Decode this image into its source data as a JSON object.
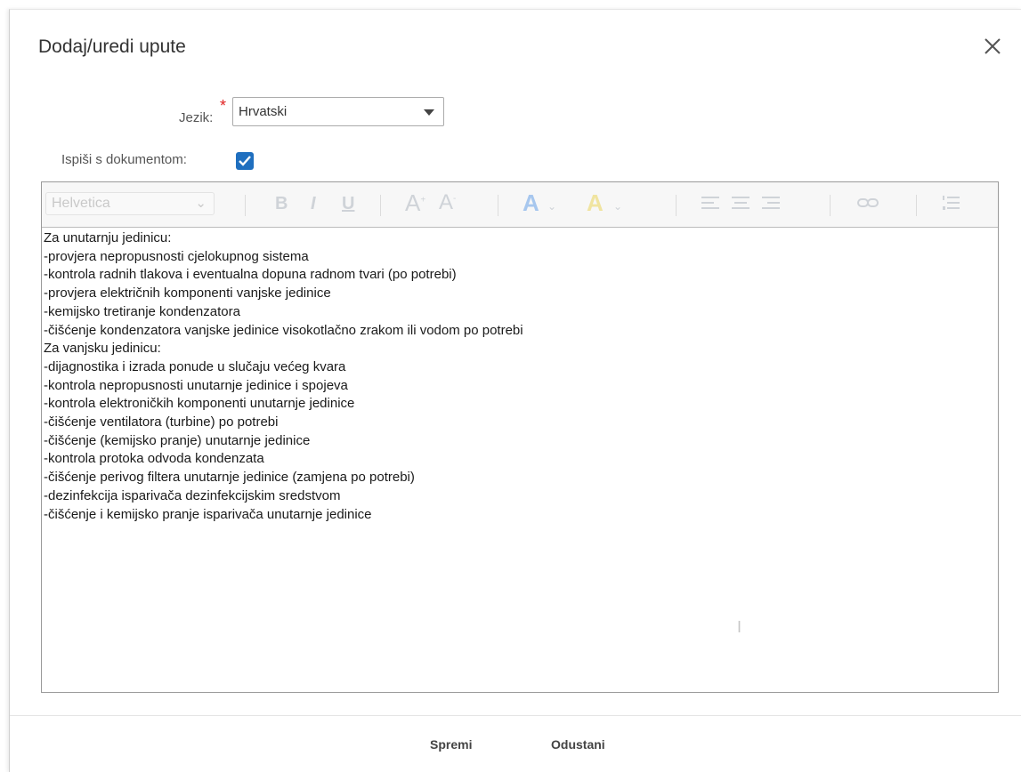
{
  "dialog": {
    "title": "Dodaj/uredi upute",
    "close_icon": "close-icon"
  },
  "form": {
    "language_label": "Jezik:",
    "required_mark": "*",
    "language_value": "Hrvatski",
    "print_label": "Ispiši s dokumentom:",
    "print_checked": true
  },
  "toolbar": {
    "font_value": "Helvetica",
    "bold": "B",
    "italic": "I",
    "underline": "U",
    "icons": [
      "font-size-increase-icon",
      "font-size-decrease-icon",
      "text-color-icon",
      "highlight-color-icon",
      "align-left-icon",
      "align-center-icon",
      "align-right-icon",
      "link-icon",
      "numbered-list-icon"
    ]
  },
  "editor": {
    "lines": [
      "Za unutarnju jedinicu:",
      "-provjera nepropusnosti cjelokupnog sistema",
      "-kontrola radnih tlakova i eventualna dopuna radnom tvari (po potrebi)",
      "-provjera električnih komponenti vanjske jedinice",
      "-kemijsko tretiranje kondenzatora",
      "-čišćenje kondenzatora vanjske jedinice visokotlačno zrakom ili vodom po potrebi",
      "Za vanjsku jedinicu:",
      "-dijagnostika i izrada ponude u slučaju većeg kvara",
      "-kontrola nepropusnosti unutarnje jedinice i spojeva",
      "-kontrola elektroničkih komponenti unutarnje jedinice",
      "-čišćenje ventilatora (turbine) po potrebi",
      "-čišćenje (kemijsko pranje) unutarnje jedinice",
      "-kontrola protoka odvoda kondenzata",
      "-čišćenje perivog filtera unutarnje jedinice (zamjena po potrebi)",
      "-dezinfekcija isparivača dezinfekcijskim sredstvom",
      "-čišćenje i kemijsko pranje isparivača unutarnje jedinice"
    ]
  },
  "footer": {
    "save_label": "Spremi",
    "cancel_label": "Odustani"
  },
  "colors": {
    "checkbox": "#1f6fbf",
    "required": "#e02020"
  }
}
